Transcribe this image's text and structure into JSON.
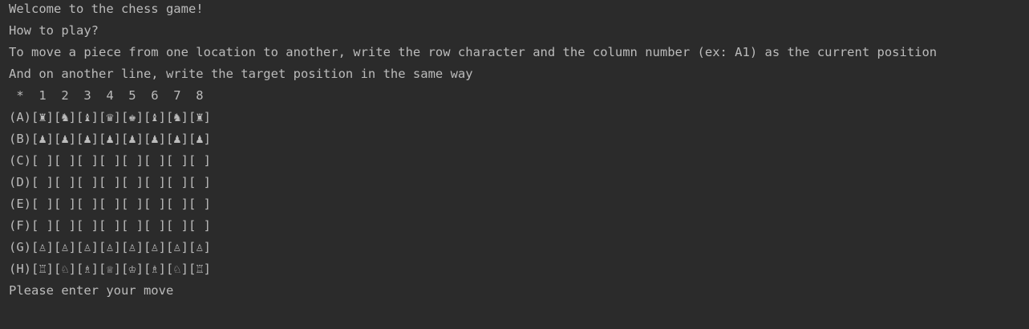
{
  "console": {
    "lines": [
      "Welcome to the chess game!",
      "How to play?",
      "To move a piece from one location to another, write the row character and the column number (ex: A1) as the current position",
      "And on another line, write the target position in the same way",
      " *  1  2  3  4  5  6  7  8",
      "(A)[♜][♞][♝][♛][♚][♝][♞][♜]",
      "(B)[♟][♟][♟][♟][♟][♟][♟][♟]",
      "(C)[ ][ ][ ][ ][ ][ ][ ][ ]",
      "(D)[ ][ ][ ][ ][ ][ ][ ][ ]",
      "(E)[ ][ ][ ][ ][ ][ ][ ][ ]",
      "(F)[ ][ ][ ][ ][ ][ ][ ][ ]",
      "(G)[♙][♙][♙][♙][♙][♙][♙][♙]",
      "(H)[♖][♘][♗][♕][♔][♗][♘][♖]",
      "Please enter your move"
    ]
  },
  "colors": {
    "background": "#2b2b2b",
    "text": "#bbbbbb"
  }
}
